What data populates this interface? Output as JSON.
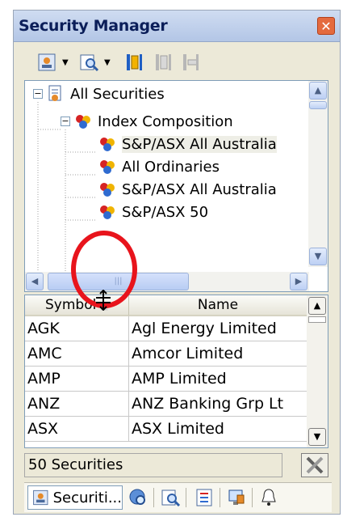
{
  "window": {
    "title": "Security Manager",
    "close_glyph": "✕"
  },
  "tree": {
    "root_label": "All Securities",
    "group_label": "Index Composition",
    "items": [
      "S&P/ASX All Australia",
      "All Ordinaries",
      "S&P/ASX All Australia",
      "S&P/ASX 50"
    ],
    "selected_index": 0
  },
  "grid": {
    "columns": [
      "Symbol",
      "Name"
    ],
    "rows": [
      {
        "symbol": "AGK",
        "name": "Agl Energy Limited"
      },
      {
        "symbol": "AMC",
        "name": "Amcor Limited"
      },
      {
        "symbol": "AMP",
        "name": "AMP Limited"
      },
      {
        "symbol": "ANZ",
        "name": "ANZ Banking Grp Lt"
      },
      {
        "symbol": "ASX",
        "name": "ASX Limited"
      }
    ]
  },
  "status": {
    "count_text": "50 Securities"
  },
  "tabs": {
    "active_label": "Securiti..."
  },
  "colors": {
    "accent": "#316ac5",
    "annotation": "#e8141c"
  }
}
